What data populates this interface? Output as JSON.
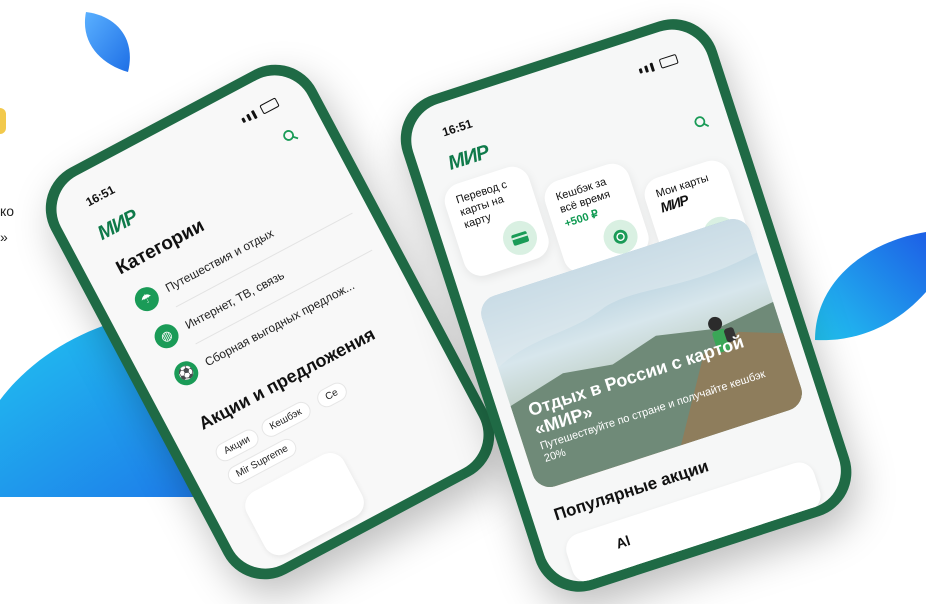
{
  "colors": {
    "brand_green": "#0f7a4a",
    "phone_body": "#1f6a45",
    "accent_blue": "#1e6fe6"
  },
  "edge_text": {
    "line1": "ко",
    "line2": "»"
  },
  "phone_left": {
    "time": "16:51",
    "logo": "МИР",
    "categories_title": "Категории",
    "categories": [
      {
        "label": "Путешествия и отдых",
        "icon": "umbrella-icon"
      },
      {
        "label": "Интернет, ТВ, связь",
        "icon": "globe-icon"
      },
      {
        "label": "Сборная выгодных предлож...",
        "icon": "football-icon"
      }
    ],
    "promos_title": "Акции и предложения",
    "chips": [
      "Акции",
      "Кешбэк",
      "Се",
      "Mir Supreme"
    ]
  },
  "phone_right": {
    "time": "16:51",
    "logo": "МИР",
    "tiles": [
      {
        "text": "Перевод с карты на карту",
        "icon": "card-transfer-icon"
      },
      {
        "text": "Кешбэк за всё время",
        "amount": "+500 ₽",
        "icon": "coins-icon"
      },
      {
        "text": "Мои карты",
        "logo": "МИР",
        "icon": "card-icon"
      }
    ],
    "banner": {
      "title": "Отдых в России с картой «МИР»",
      "subtitle": "Путешествуйте по стране и получайте кешбэк 20%"
    },
    "popular_title": "Популярные акции",
    "popular_item": "Al"
  }
}
